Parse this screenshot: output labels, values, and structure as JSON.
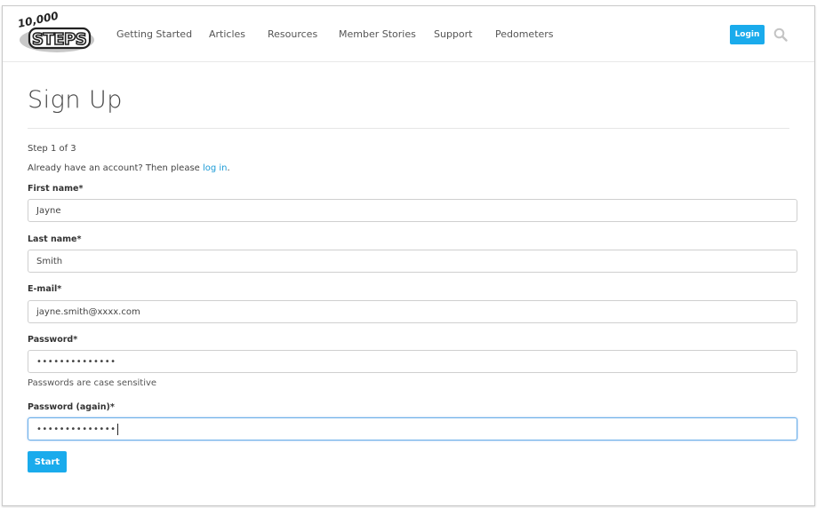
{
  "header": {
    "logo_text": "10,000 STEPS",
    "nav": [
      "Getting Started",
      "Articles",
      "Resources",
      "Member Stories",
      "Support",
      "Pedometers"
    ],
    "login_label": "Login",
    "search_icon": "search-icon"
  },
  "page": {
    "title": "Sign Up",
    "step": "Step 1 of 3",
    "account_text": "Already have an account? Then please ",
    "account_link": "log in",
    "account_end": "."
  },
  "form": {
    "first_name_label": "First name*",
    "first_name_value": "Jayne",
    "last_name_label": "Last name*",
    "last_name_value": "Smith",
    "email_label": "E-mail*",
    "email_value": "jayne.smith@xxxx.com",
    "password_label": "Password*",
    "password_value": "••••••••••••••",
    "password_hint": "Passwords are case sensitive",
    "password_again_label": "Password (again)*",
    "password_again_value": "••••••••••••••",
    "start_label": "Start"
  },
  "colors": {
    "accent": "#1aabec",
    "link": "#1a9ad6"
  }
}
